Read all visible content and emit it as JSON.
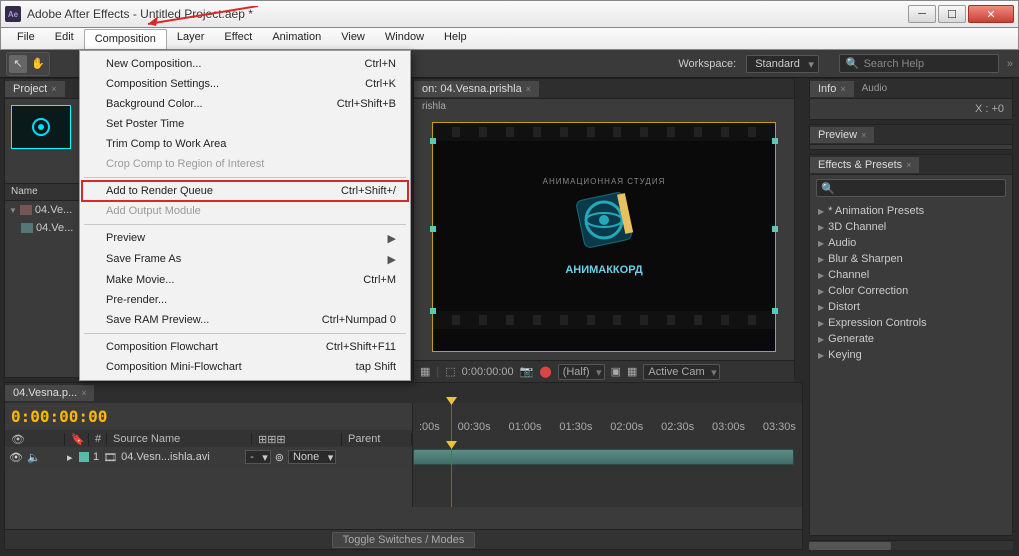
{
  "titlebar": {
    "app_icon_text": "Ae",
    "title": "Adobe After Effects - Untitled Project.aep *"
  },
  "menubar": {
    "items": [
      "File",
      "Edit",
      "Composition",
      "Layer",
      "Effect",
      "Animation",
      "View",
      "Window",
      "Help"
    ],
    "active_index": 2
  },
  "dropdown": {
    "groups": [
      [
        {
          "label": "New Composition...",
          "shortcut": "Ctrl+N",
          "disabled": false
        },
        {
          "label": "Composition Settings...",
          "shortcut": "Ctrl+K",
          "disabled": false
        },
        {
          "label": "Background Color...",
          "shortcut": "Ctrl+Shift+B",
          "disabled": false
        },
        {
          "label": "Set Poster Time",
          "shortcut": "",
          "disabled": false
        },
        {
          "label": "Trim Comp to Work Area",
          "shortcut": "",
          "disabled": false
        },
        {
          "label": "Crop Comp to Region of Interest",
          "shortcut": "",
          "disabled": true
        }
      ],
      [
        {
          "label": "Add to Render Queue",
          "shortcut": "Ctrl+Shift+/",
          "disabled": false,
          "highlight": true
        },
        {
          "label": "Add Output Module",
          "shortcut": "",
          "disabled": true
        }
      ],
      [
        {
          "label": "Preview",
          "shortcut": "",
          "disabled": false,
          "submenu": true
        },
        {
          "label": "Save Frame As",
          "shortcut": "",
          "disabled": false,
          "submenu": true
        },
        {
          "label": "Make Movie...",
          "shortcut": "Ctrl+M",
          "disabled": false
        },
        {
          "label": "Pre-render...",
          "shortcut": "",
          "disabled": false
        },
        {
          "label": "Save RAM Preview...",
          "shortcut": "Ctrl+Numpad 0",
          "disabled": false
        }
      ],
      [
        {
          "label": "Composition Flowchart",
          "shortcut": "Ctrl+Shift+F11",
          "disabled": false
        },
        {
          "label": "Composition Mini-Flowchart",
          "shortcut": "tap Shift",
          "disabled": false
        }
      ]
    ]
  },
  "toolbar": {
    "workspace_label": "Workspace:",
    "workspace_value": "Standard",
    "search_placeholder": "Search Help",
    "chevs": "»"
  },
  "project": {
    "tab": "Project",
    "col_header": "Name",
    "items": [
      {
        "name": "04.Ve..."
      },
      {
        "name": "04.Ve..."
      }
    ]
  },
  "comp": {
    "tab_prefix": "on: 04.Vesna.prishla",
    "crumb": "rishla",
    "text_top": "АНИМАЦИОННАЯ СТУДИЯ",
    "text_bot": "АНИМАККОРД",
    "timecode": "0:00:00:00",
    "res": "(Half)",
    "cam": "Active Cam"
  },
  "right": {
    "info_tab": "Info",
    "audio_tab": "Audio",
    "info_x_label": "X :",
    "info_x_val": "+0",
    "preview_tab": "Preview",
    "effects_tab": "Effects & Presets",
    "effects_categories": [
      "* Animation Presets",
      "3D Channel",
      "Audio",
      "Blur & Sharpen",
      "Channel",
      "Color Correction",
      "Distort",
      "Expression Controls",
      "Generate",
      "Keying"
    ]
  },
  "timeline": {
    "tab": "04.Vesna.p...",
    "timecode": "0:00:00:00",
    "col_source": "Source Name",
    "col_parent": "Parent",
    "ruler": [
      ":00s",
      "00:30s",
      "01:00s",
      "01:30s",
      "02:00s",
      "02:30s",
      "03:00s",
      "03:30s"
    ],
    "layer": {
      "index": "1",
      "name": "04.Vesn...ishla.avi",
      "mode": "-",
      "parent": "None"
    },
    "toggle": "Toggle Switches / Modes"
  }
}
